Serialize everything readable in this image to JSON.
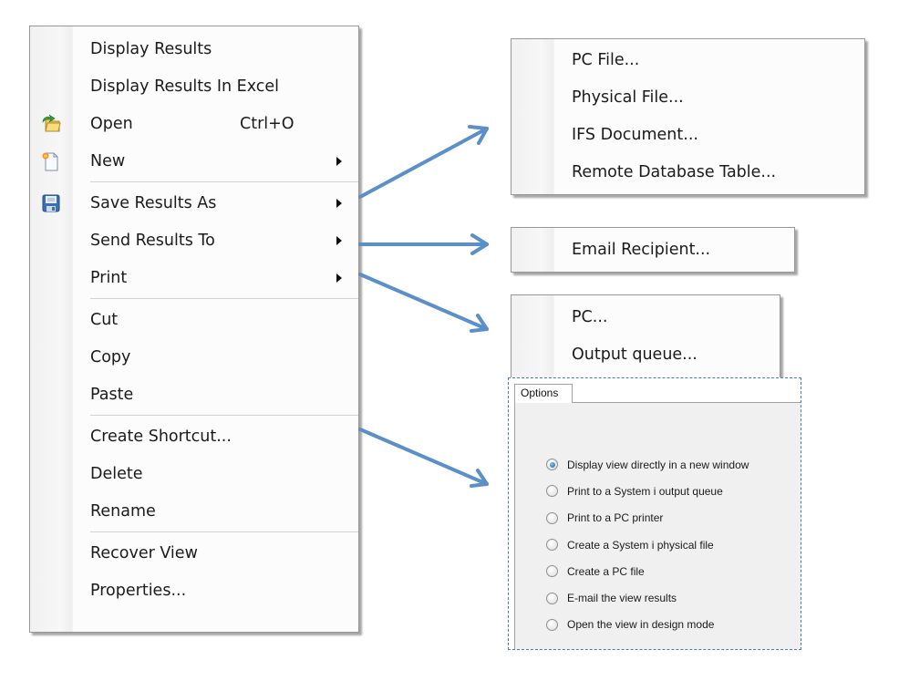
{
  "main_menu": {
    "groups": [
      [
        {
          "label": "Display Results",
          "icon": "",
          "shortcut": "",
          "submenu": false
        },
        {
          "label": "Display Results In Excel",
          "icon": "",
          "shortcut": "",
          "submenu": false
        },
        {
          "label": "Open",
          "icon": "open-folder-icon",
          "shortcut": "Ctrl+O",
          "submenu": false
        },
        {
          "label": "New",
          "icon": "new-document-icon",
          "shortcut": "",
          "submenu": true
        }
      ],
      [
        {
          "label": "Save Results As",
          "icon": "save-disk-icon",
          "shortcut": "",
          "submenu": true
        },
        {
          "label": "Send Results To",
          "icon": "",
          "shortcut": "",
          "submenu": true
        },
        {
          "label": "Print",
          "icon": "",
          "shortcut": "",
          "submenu": true
        }
      ],
      [
        {
          "label": "Cut",
          "icon": "",
          "shortcut": "",
          "submenu": false
        },
        {
          "label": "Copy",
          "icon": "",
          "shortcut": "",
          "submenu": false
        },
        {
          "label": "Paste",
          "icon": "",
          "shortcut": "",
          "submenu": false
        }
      ],
      [
        {
          "label": "Create Shortcut...",
          "icon": "",
          "shortcut": "",
          "submenu": false
        },
        {
          "label": "Delete",
          "icon": "",
          "shortcut": "",
          "submenu": false
        },
        {
          "label": "Rename",
          "icon": "",
          "shortcut": "",
          "submenu": false
        }
      ],
      [
        {
          "label": "Recover View",
          "icon": "",
          "shortcut": "",
          "submenu": false
        },
        {
          "label": "Properties...",
          "icon": "",
          "shortcut": "",
          "submenu": false
        }
      ]
    ]
  },
  "save_submenu": {
    "items": [
      "PC File...",
      "Physical File...",
      "IFS Document...",
      "Remote Database Table..."
    ]
  },
  "send_submenu": {
    "items": [
      "Email Recipient..."
    ]
  },
  "print_submenu": {
    "items": [
      "PC...",
      "Output queue..."
    ]
  },
  "options_panel": {
    "tab_label": "Options",
    "selected_index": 0,
    "options": [
      "Display view directly in a new window",
      "Print to a System i output queue",
      "Print to a PC printer",
      "Create a System i physical file",
      "Create a PC file",
      "E-mail the view results",
      "Open the view in design mode"
    ]
  },
  "colors": {
    "annotation_arrow": "#5b8fc7",
    "dashed_border": "#4b7ab0"
  }
}
